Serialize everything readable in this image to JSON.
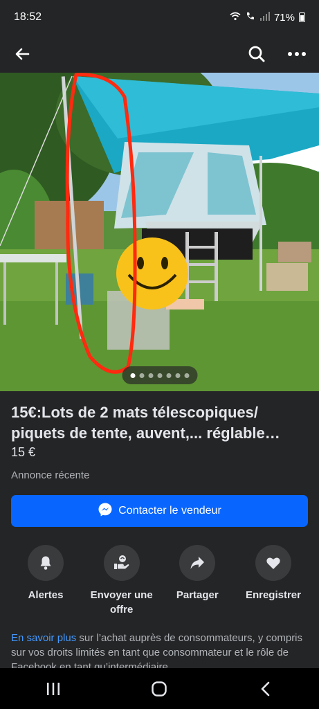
{
  "status_bar": {
    "time": "18:52",
    "battery_text": "71%",
    "icons": [
      "wifi-icon",
      "wifi-calling-icon",
      "signal-icon",
      "battery-icon"
    ]
  },
  "header": {
    "icons": [
      "back-arrow-icon",
      "search-icon",
      "more-icon"
    ]
  },
  "photo": {
    "description_icon": "product-photo",
    "dots_total": 7,
    "active_dot": 1
  },
  "listing": {
    "title": "15€:Lots de 2 mats télescopiques/ piquets de tente, auvent,... réglable…",
    "price": "15 €",
    "recent": "Annonce récente",
    "contact_button": "Contacter le vendeur",
    "contact_icon": "messenger-icon",
    "accent_color": "#0866ff"
  },
  "actions": [
    {
      "label": "Alertes",
      "icon": "bell-icon"
    },
    {
      "label": "Envoyer une offre",
      "icon": "offer-icon"
    },
    {
      "label": "Partager",
      "icon": "share-icon"
    },
    {
      "label": "Enregistrer",
      "icon": "heart-icon"
    }
  ],
  "legal": {
    "link": "En savoir plus",
    "text": " sur l’achat auprès de consommateurs, y compris sur vos droits limités en tant que consommateur et le rôle de Facebook en tant qu’intermédiaire"
  },
  "nav_bar": {
    "icons": [
      "recent-apps-icon",
      "home-icon",
      "back-icon"
    ]
  }
}
